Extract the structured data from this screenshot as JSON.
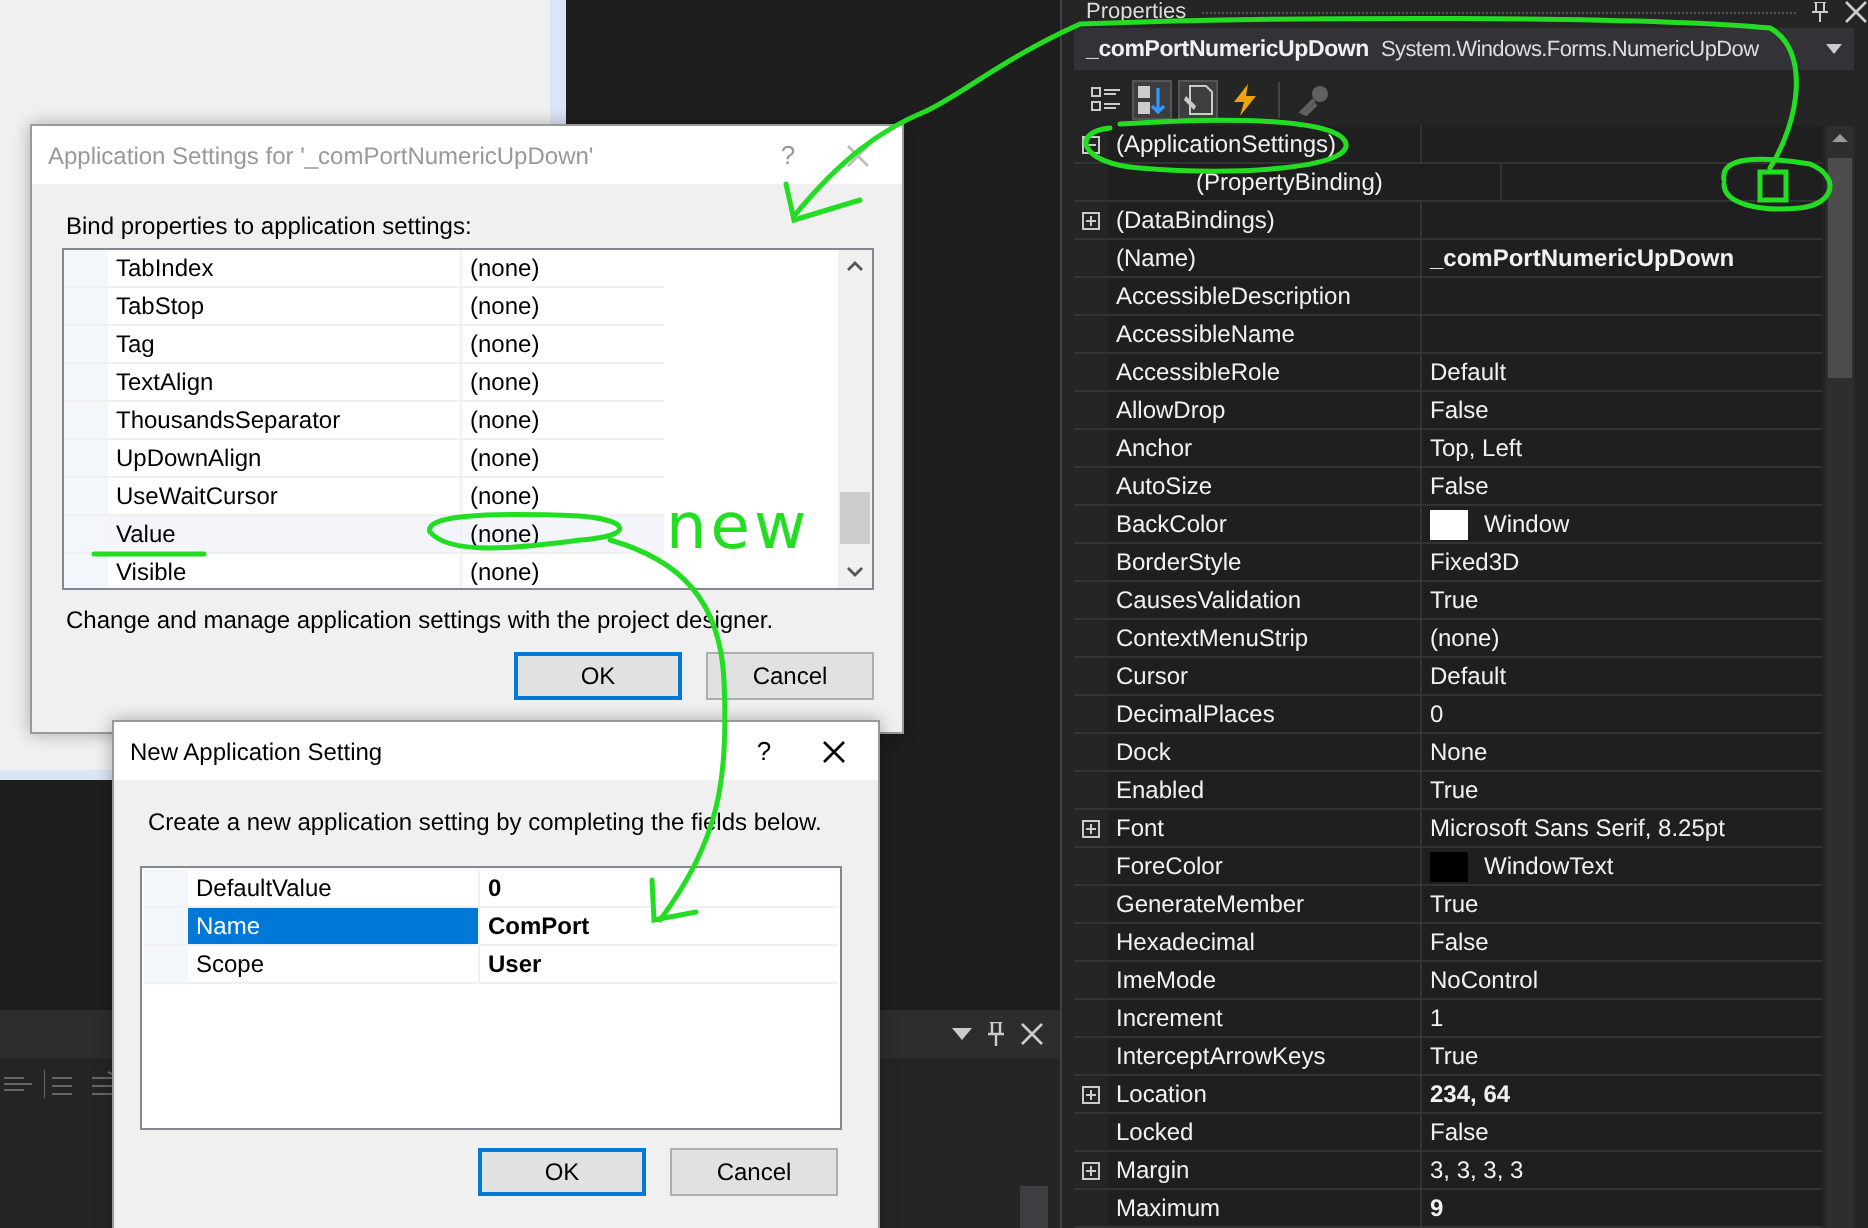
{
  "properties_panel": {
    "title": "Properties",
    "object_name": "_comPortNumericUpDown",
    "object_type": "System.Windows.Forms.NumericUpDow",
    "toolbar": [
      {
        "kind": "categorized",
        "selected": false,
        "disabled": false
      },
      {
        "kind": "alphabetical",
        "selected": true,
        "disabled": false
      },
      {
        "kind": "properties",
        "selected": true,
        "disabled": false
      },
      {
        "kind": "events",
        "selected": false,
        "disabled": false
      },
      {
        "kind": "property-pages",
        "selected": false,
        "disabled": true
      }
    ],
    "rows": [
      {
        "name": "(ApplicationSettings)",
        "modified": false,
        "expanded": true,
        "children": [
          {
            "name": "(PropertyBinding)",
            "modified": false
          }
        ]
      },
      {
        "name": "(DataBindings)",
        "modified": false,
        "expanded": false
      },
      {
        "name": "(Name)",
        "value": "_comPortNumericUpDown",
        "modified": true
      },
      {
        "name": "AccessibleDescription",
        "modified": false
      },
      {
        "name": "AccessibleName",
        "modified": false
      },
      {
        "name": "AccessibleRole",
        "value": "Default",
        "modified": false
      },
      {
        "name": "AllowDrop",
        "value": "False",
        "modified": false
      },
      {
        "name": "Anchor",
        "value": "Top, Left",
        "modified": false
      },
      {
        "name": "AutoSize",
        "value": "False",
        "modified": false
      },
      {
        "name": "BackColor",
        "value": "Window",
        "modified": false,
        "color": "#ffffff"
      },
      {
        "name": "BorderStyle",
        "value": "Fixed3D",
        "modified": false
      },
      {
        "name": "CausesValidation",
        "value": "True",
        "modified": false
      },
      {
        "name": "ContextMenuStrip",
        "value": "(none)",
        "modified": false
      },
      {
        "name": "Cursor",
        "value": "Default",
        "modified": false
      },
      {
        "name": "DecimalPlaces",
        "value": "0",
        "modified": false
      },
      {
        "name": "Dock",
        "value": "None",
        "modified": false
      },
      {
        "name": "Enabled",
        "value": "True",
        "modified": false
      },
      {
        "name": "Font",
        "value": "Microsoft Sans Serif, 8.25pt",
        "modified": false,
        "expanded": false
      },
      {
        "name": "ForeColor",
        "value": "WindowText",
        "modified": false,
        "color": "#000000"
      },
      {
        "name": "GenerateMember",
        "value": "True",
        "modified": false
      },
      {
        "name": "Hexadecimal",
        "value": "False",
        "modified": false
      },
      {
        "name": "ImeMode",
        "value": "NoControl",
        "modified": false
      },
      {
        "name": "Increment",
        "value": "1",
        "modified": false
      },
      {
        "name": "InterceptArrowKeys",
        "value": "True",
        "modified": false
      },
      {
        "name": "Location",
        "value": "234, 64",
        "modified": true,
        "expanded": false
      },
      {
        "name": "Locked",
        "value": "False",
        "modified": false
      },
      {
        "name": "Margin",
        "value": "3, 3, 3, 3",
        "modified": false,
        "expanded": false
      },
      {
        "name": "Maximum",
        "value": "9",
        "modified": true
      }
    ]
  },
  "settings_dialog": {
    "title": "Application Settings for '_comPortNumericUpDown'",
    "active": false,
    "help": "?",
    "label": "Bind properties to application settings:",
    "rows": [
      {
        "name": "TabIndex",
        "value": "(none)",
        "selected": false
      },
      {
        "name": "TabStop",
        "value": "(none)",
        "selected": false
      },
      {
        "name": "Tag",
        "value": "(none)",
        "selected": false
      },
      {
        "name": "TextAlign",
        "value": "(none)",
        "selected": false
      },
      {
        "name": "ThousandsSeparator",
        "value": "(none)",
        "selected": false
      },
      {
        "name": "UpDownAlign",
        "value": "(none)",
        "selected": false
      },
      {
        "name": "UseWaitCursor",
        "value": "(none)",
        "selected": false
      },
      {
        "name": "Value",
        "value": "(none)",
        "selected": true
      },
      {
        "name": "Visible",
        "value": "(none)",
        "selected": false
      }
    ],
    "description": "Change and manage application settings with the project designer.",
    "buttons": [
      {
        "label": "OK",
        "default": true
      },
      {
        "label": "Cancel",
        "default": false
      }
    ]
  },
  "new_setting_dialog": {
    "title": "New Application Setting",
    "active": true,
    "help": "?",
    "instruction": "Create a new application setting by completing the fields below.",
    "rows": [
      {
        "name": "DefaultValue",
        "value": "0",
        "selected": false
      },
      {
        "name": "Name",
        "value": "ComPort",
        "selected": true
      },
      {
        "name": "Scope",
        "value": "User",
        "selected": false
      }
    ],
    "buttons": [
      {
        "label": "OK",
        "default": true
      },
      {
        "label": "Cancel",
        "default": false
      }
    ]
  },
  "annotation": {
    "text": "new"
  }
}
